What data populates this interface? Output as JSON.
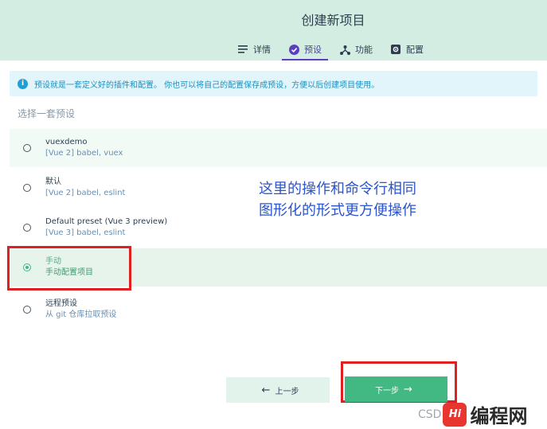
{
  "header": {
    "title": "创建新项目",
    "tabs": [
      {
        "label": "详情",
        "icon": "list-icon",
        "active": false
      },
      {
        "label": "预设",
        "icon": "check-circle-icon",
        "active": true
      },
      {
        "label": "功能",
        "icon": "fork-icon",
        "active": false
      },
      {
        "label": "配置",
        "icon": "gear-icon",
        "active": false
      }
    ]
  },
  "info": {
    "text": "预设就是一套定义好的插件和配置。 你也可以将自己的配置保存成预设，方便以后创建项目使用。"
  },
  "section_label": "选择一套预设",
  "presets": [
    {
      "name": "vuexdemo",
      "desc": "[Vue 2] babel, vuex",
      "selected": false
    },
    {
      "name": "默认",
      "desc": "[Vue 2] babel, eslint",
      "selected": false
    },
    {
      "name": "Default preset (Vue 3 preview)",
      "desc": "[Vue 3] babel, eslint",
      "selected": false
    },
    {
      "name": "手动",
      "desc": "手动配置项目",
      "selected": true
    },
    {
      "name": "远程预设",
      "desc": "从 git 仓库拉取预设",
      "selected": false
    }
  ],
  "annotation": {
    "line1": "这里的操作和命令行相同",
    "line2": "图形化的形式更方便操作"
  },
  "buttons": {
    "prev": "上一步",
    "next": "下一步"
  },
  "watermark": {
    "csd": "CSD",
    "logo": "Hi",
    "text": "编程网"
  },
  "colors": {
    "accent": "#42b983",
    "header_bg": "#d4ede3",
    "info_blue": "#1ea0d6",
    "annotation": "#2b55c9",
    "highlight_red": "#e02020"
  }
}
